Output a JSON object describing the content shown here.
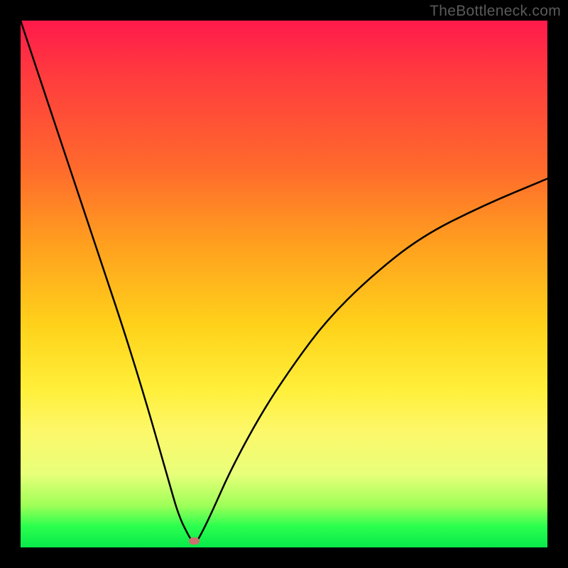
{
  "watermark": "TheBottleneck.com",
  "chart_data": {
    "type": "line",
    "title": "",
    "xlabel": "",
    "ylabel": "",
    "xlim": [
      0,
      100
    ],
    "ylim": [
      0,
      100
    ],
    "series": [
      {
        "name": "bottleneck-curve",
        "x": [
          0,
          4,
          8,
          12,
          16,
          20,
          24,
          28,
          30,
          32,
          33,
          34,
          36,
          40,
          46,
          52,
          58,
          66,
          76,
          88,
          100
        ],
        "y": [
          100,
          88,
          76,
          64,
          52,
          40,
          27,
          13,
          6,
          2,
          0.5,
          2,
          6,
          15,
          26,
          35,
          43,
          51,
          59,
          65,
          70
        ]
      }
    ],
    "annotations": [
      {
        "name": "optimal-marker",
        "x": 33,
        "y": 1.2,
        "color": "#cc6f6f"
      }
    ],
    "background_gradient": {
      "direction": "vertical",
      "stops": [
        {
          "pos": 0.0,
          "color": "#ff1a4b"
        },
        {
          "pos": 0.28,
          "color": "#ff6a2c"
        },
        {
          "pos": 0.58,
          "color": "#ffd21a"
        },
        {
          "pos": 0.86,
          "color": "#e9ff7a"
        },
        {
          "pos": 1.0,
          "color": "#07e84a"
        }
      ]
    }
  }
}
